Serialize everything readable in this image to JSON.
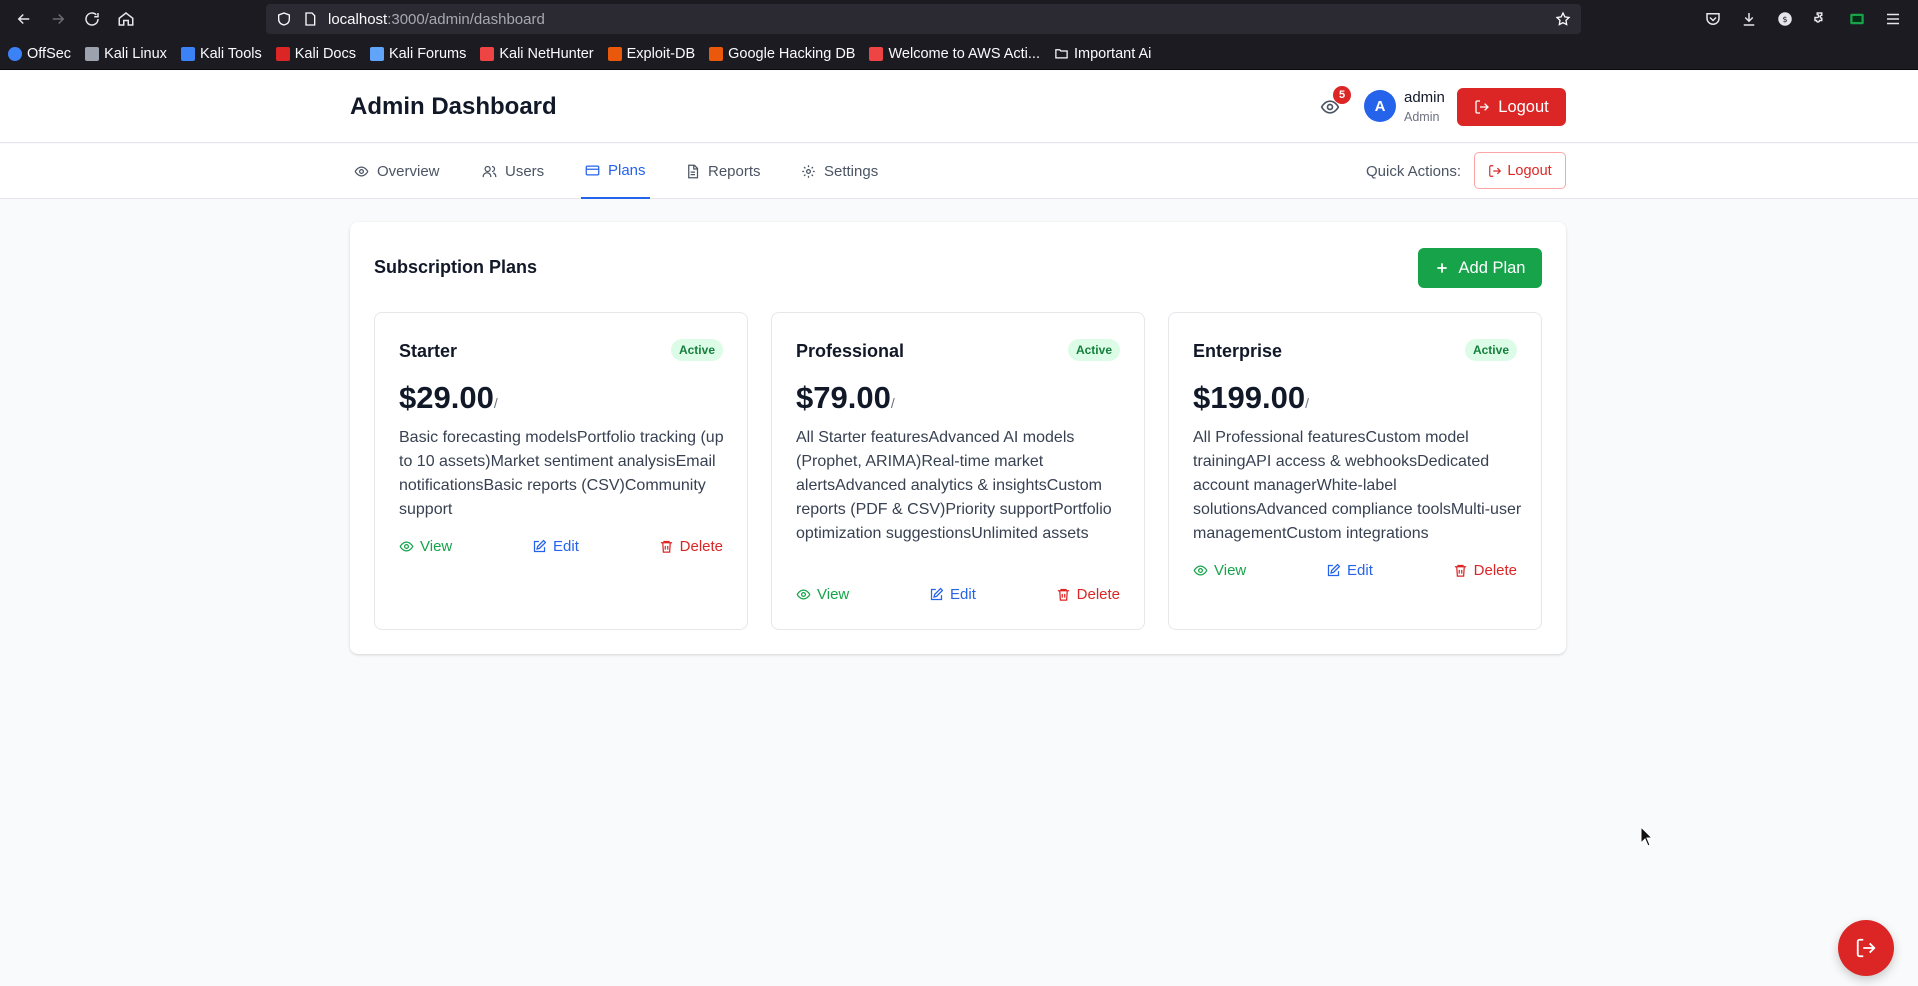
{
  "browser": {
    "url_host": "localhost",
    "url_path": ":3000/admin/dashboard",
    "bookmarks": [
      {
        "label": "OffSec",
        "color": "#3b82f6"
      },
      {
        "label": "Kali Linux",
        "color": "#9ca3af"
      },
      {
        "label": "Kali Tools",
        "color": "#3b82f6"
      },
      {
        "label": "Kali Docs",
        "color": "#dc2626"
      },
      {
        "label": "Kali Forums",
        "color": "#60a5fa"
      },
      {
        "label": "Kali NetHunter",
        "color": "#ef4444"
      },
      {
        "label": "Exploit-DB",
        "color": "#ea580c"
      },
      {
        "label": "Google Hacking DB",
        "color": "#ea580c"
      },
      {
        "label": "Welcome to AWS Acti...",
        "color": "#ef4444"
      },
      {
        "label": "Important Ai",
        "color": "folder"
      }
    ]
  },
  "header": {
    "title": "Admin Dashboard",
    "notification_count": "5",
    "avatar_initial": "A",
    "user_name": "admin",
    "user_role": "Admin",
    "logout_label": "Logout"
  },
  "tabs": [
    {
      "label": "Overview",
      "icon": "eye-icon"
    },
    {
      "label": "Users",
      "icon": "users-icon"
    },
    {
      "label": "Plans",
      "icon": "credit-card-icon",
      "active": true
    },
    {
      "label": "Reports",
      "icon": "file-icon"
    },
    {
      "label": "Settings",
      "icon": "gear-icon"
    }
  ],
  "quick_actions": {
    "label": "Quick Actions:",
    "logout_label": "Logout"
  },
  "plans_panel": {
    "title": "Subscription Plans",
    "add_label": "Add Plan",
    "plans": [
      {
        "name": "Starter",
        "status": "Active",
        "price": "$29.00",
        "period": "/",
        "description": "Basic forecasting modelsPortfolio tracking (up to 10 assets)Market sentiment analysisEmail notificationsBasic reports (CSV)Community support",
        "view_label": "View",
        "edit_label": "Edit",
        "delete_label": "Delete"
      },
      {
        "name": "Professional",
        "status": "Active",
        "price": "$79.00",
        "period": "/",
        "description": "All Starter featuresAdvanced AI models (Prophet, ARIMA)Real-time market alertsAdvanced analytics & insightsCustom reports (PDF & CSV)Priority supportPortfolio optimization suggestionsUnlimited assets",
        "view_label": "View",
        "edit_label": "Edit",
        "delete_label": "Delete"
      },
      {
        "name": "Enterprise",
        "status": "Active",
        "price": "$199.00",
        "period": "/",
        "description": "All Professional featuresCustom model trainingAPI access & webhooksDedicated account managerWhite-label solutionsAdvanced compliance toolsMulti-user managementCustom integrations",
        "view_label": "View",
        "edit_label": "Edit",
        "delete_label": "Delete"
      }
    ]
  },
  "colors": {
    "primary": "#2563eb",
    "danger": "#dc2626",
    "success": "#16a34a"
  }
}
